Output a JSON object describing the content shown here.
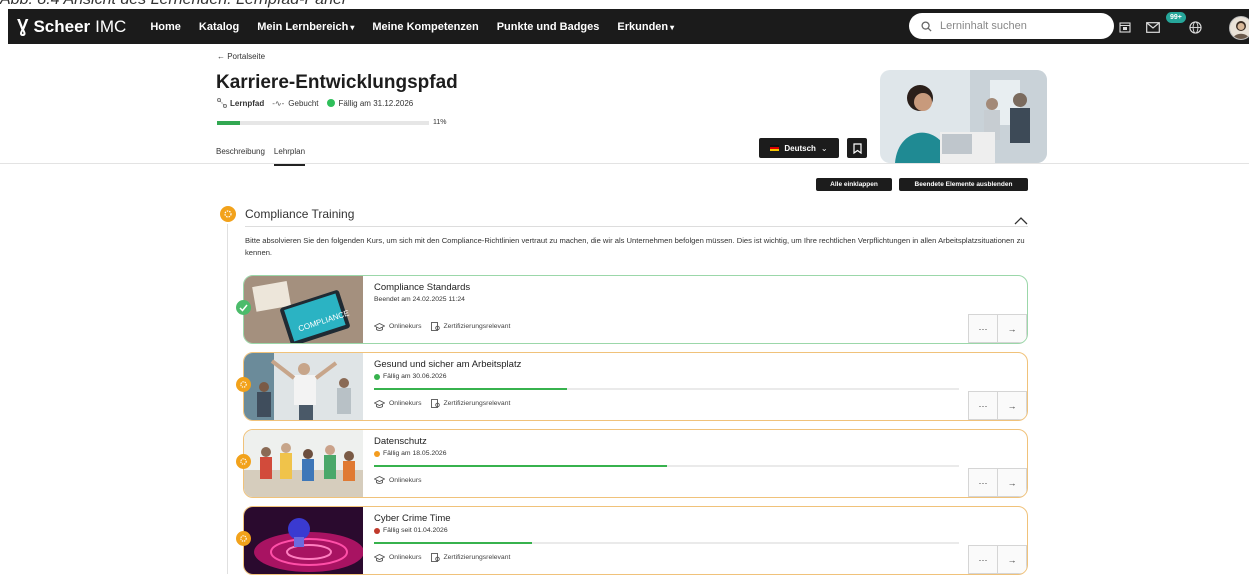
{
  "caption": "Abb. 8.4 Ansicht des Lernenden: Lernpfad-Panel",
  "topbar": {
    "brand_bold": "Scheer",
    "brand_rest": "IMC",
    "nav": [
      {
        "label": "Home",
        "dropdown": false
      },
      {
        "label": "Katalog",
        "dropdown": false
      },
      {
        "label": "Mein Lernbereich",
        "dropdown": true
      },
      {
        "label": "Meine Kompetenzen",
        "dropdown": false
      },
      {
        "label": "Punkte und Badges",
        "dropdown": false
      },
      {
        "label": "Erkunden",
        "dropdown": true
      }
    ],
    "search_placeholder": "Lerninhalt suchen",
    "notification_badge": "99+",
    "icons": [
      "calendar-icon",
      "mail-icon",
      "globe-icon",
      "avatar"
    ]
  },
  "header": {
    "back_link": "← Portalseite",
    "title": "Karriere-Entwicklungspfad",
    "type_label": "Lernpfad",
    "booking_status": "Gebucht",
    "due": "Fällig am 31.12.2026",
    "due_color": "#2fbf5a",
    "progress_percent": 11,
    "progress_label": "11%",
    "tabs": [
      {
        "label": "Beschreibung",
        "active": false
      },
      {
        "label": "Lehrplan",
        "active": true
      }
    ],
    "language_button": "Deutsch",
    "collapse_all": "Alle einklappen",
    "hide_finished": "Beendete Elemente ausblenden"
  },
  "section": {
    "title": "Compliance Training",
    "description": "Bitte absolvieren Sie den folgenden Kurs, um sich mit den Compliance-Richtlinien vertraut zu machen, die wir als Unternehmen befolgen müssen. Dies ist wichtig, um Ihre rechtlichen Verpflichtungen in allen Arbeitsplatzsituationen zu kennen.",
    "courses": [
      {
        "title": "Compliance Standards",
        "status": "Beendet am 24.02.2025 11:24",
        "status_dot": null,
        "progress": null,
        "tags": [
          "Onlinekurs",
          "Zertifizierungsrelevant"
        ],
        "state": "done"
      },
      {
        "title": "Gesund und sicher am Arbeitsplatz",
        "status": "Fällig am 30.06.2026",
        "status_dot": "#37b24d",
        "progress": 0.33,
        "tags": [
          "Onlinekurs",
          "Zertifizierungsrelevant"
        ],
        "state": "open"
      },
      {
        "title": "Datenschutz",
        "status": "Fällig am 18.05.2026",
        "status_dot": "#f39c1f",
        "progress": 0.5,
        "tags": [
          "Onlinekurs"
        ],
        "state": "open"
      },
      {
        "title": "Cyber Crime Time",
        "status": "Fällig seit 01.04.2026",
        "status_dot": "#c0392b",
        "progress": 0.27,
        "tags": [
          "Onlinekurs",
          "Zertifizierungsrelevant"
        ],
        "state": "open"
      }
    ],
    "more_label": "···",
    "open_label": "→"
  }
}
